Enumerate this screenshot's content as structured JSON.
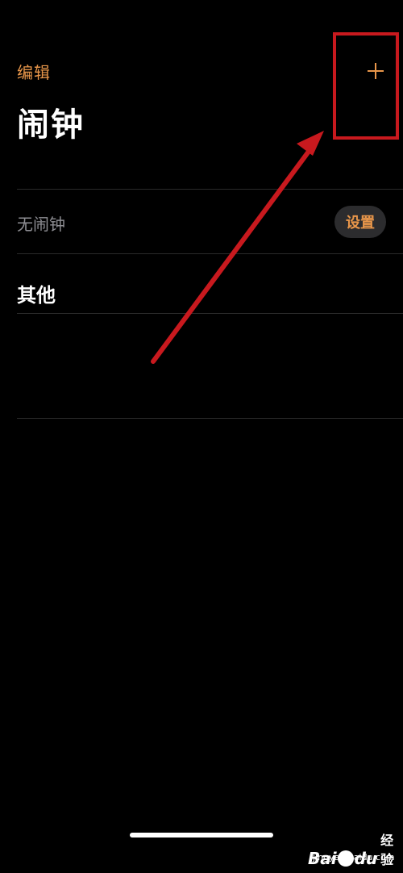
{
  "header": {
    "edit_label": "编辑",
    "add_icon": "plus-icon",
    "title": "闹钟"
  },
  "alarm_row": {
    "label": "无闹钟",
    "setup_label": "设置"
  },
  "others": {
    "title": "其他"
  },
  "colors": {
    "accent": "#e8964a",
    "background": "#000000",
    "annotation": "#c8191e",
    "muted_text": "#8e8e93",
    "button_bg": "#2c2c2e"
  },
  "watermark": {
    "brand_prefix": "Bai",
    "brand_suffix": "du",
    "brand_cn": "经验",
    "url": "jingyan.baidu.com"
  }
}
